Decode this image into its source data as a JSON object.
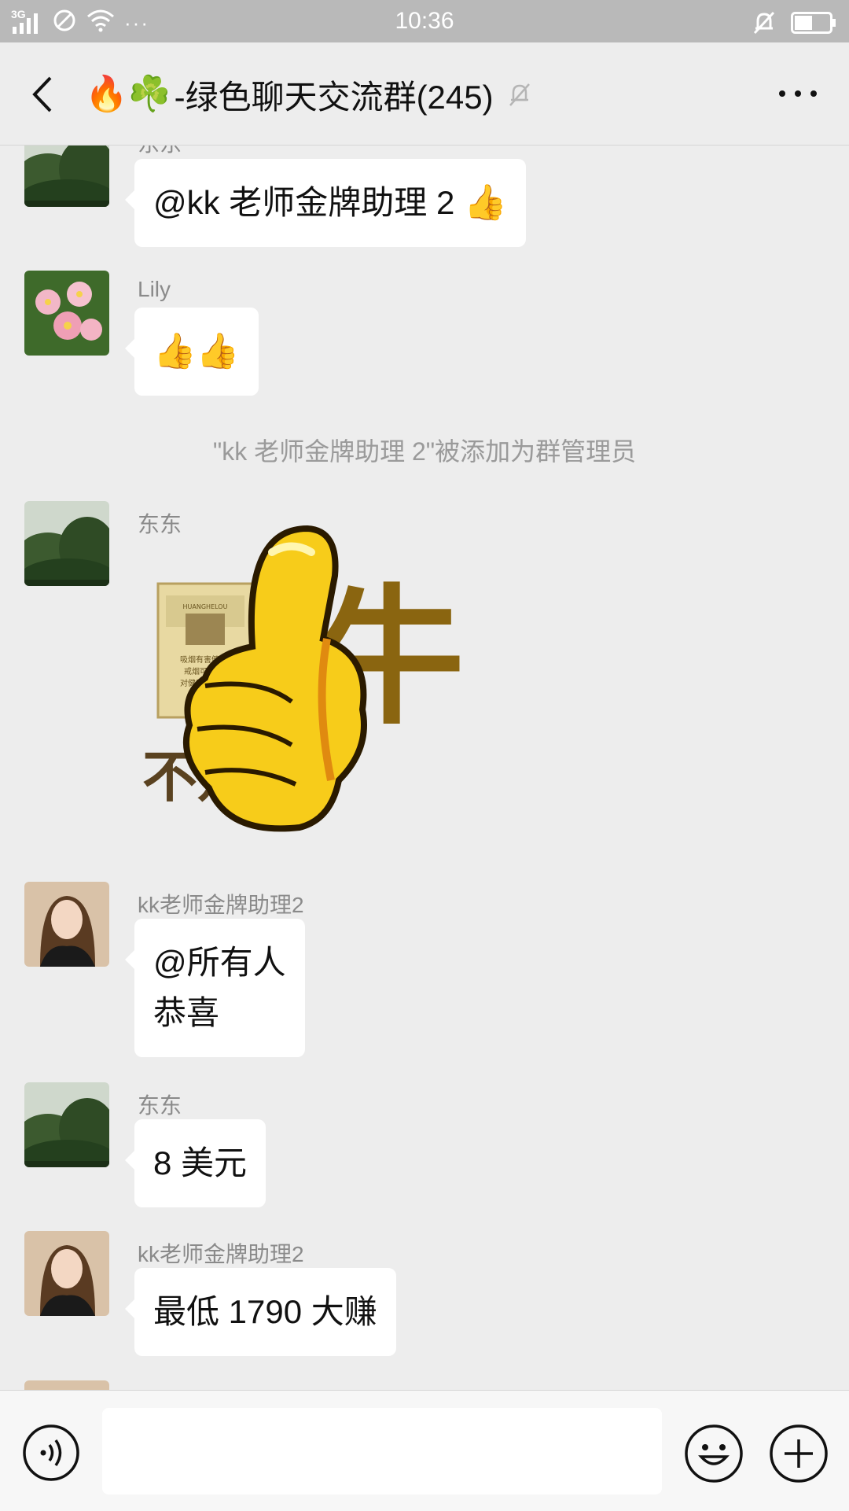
{
  "status_bar": {
    "network": "3G",
    "time": "10:36",
    "more": "···"
  },
  "header": {
    "title_emoji": "🔥☘️",
    "title": "-绿色聊天交流群(245)"
  },
  "messages": [
    {
      "sender": "东东",
      "text": "@kk 老师金牌助理 2",
      "emoji": "👍"
    },
    {
      "sender": "Lily",
      "emoji": "👍👍"
    },
    {
      "system": "\"kk 老师金牌助理 2\"被添加为群管理员"
    },
    {
      "sender": "东东",
      "sticker": "thumbs-up-sticker",
      "sticker_text": "牛",
      "sticker_text_2": "不是",
      "pack_brand": "HUANGHELOU",
      "pack_text_1": "吸烟有害健康",
      "pack_text_2": "戒烟可减少",
      "pack_text_3": "对健康的危害"
    },
    {
      "sender": "kk老师金牌助理2",
      "line1": "@所有人",
      "line2": "恭喜"
    },
    {
      "sender": "东东",
      "text": "8 美元"
    },
    {
      "sender": "kk老师金牌助理2",
      "text": "最低 1790 大赚"
    }
  ],
  "input_bar": {
    "text_value": ""
  },
  "colors": {
    "background": "#ededed",
    "bubble": "#ffffff",
    "status_bar": "#b9b9b9"
  }
}
